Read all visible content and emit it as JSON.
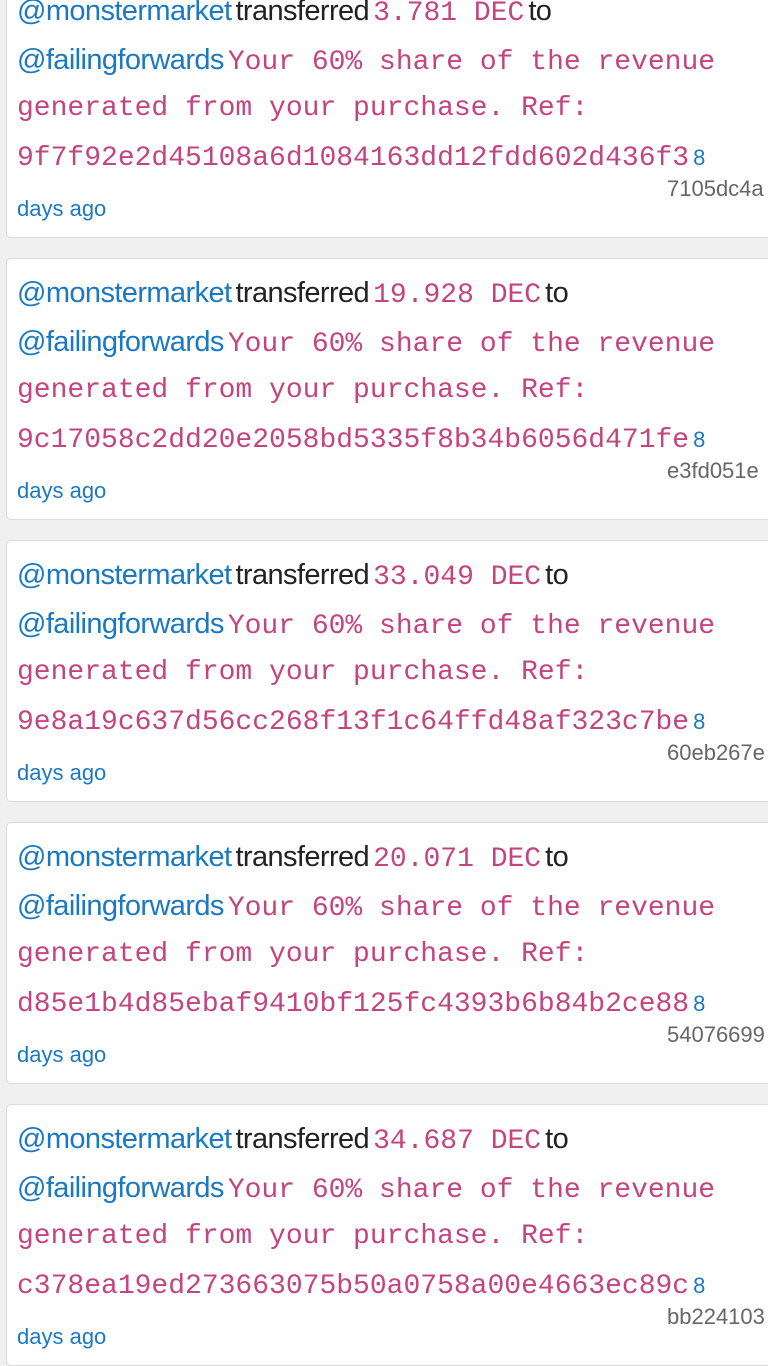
{
  "colors": {
    "user": "#1b78c2",
    "memo": "#c4447f",
    "txid": "#666666",
    "background": "#f0f0f0"
  },
  "transfers": [
    {
      "from": "@monstermarket",
      "verb": "transferred",
      "amount": "3.781 DEC",
      "to_word": "to",
      "to": "@failingforwards",
      "memo1": "Your 60% share of the revenue",
      "memo2": "generated from your purchase. Ref:",
      "ref": "9f7f92e2d45108a6d1084163dd12fdd602d436f3",
      "age_num": "8",
      "age_rest": "days ago",
      "txid": "7105dc4a"
    },
    {
      "from": "@monstermarket",
      "verb": "transferred",
      "amount": "19.928 DEC",
      "to_word": "to",
      "to": "@failingforwards",
      "memo1": "Your 60% share of the revenue",
      "memo2": "generated from your purchase. Ref:",
      "ref": "9c17058c2dd20e2058bd5335f8b34b6056d471fe",
      "age_num": "8",
      "age_rest": "days ago",
      "txid": "e3fd051e"
    },
    {
      "from": "@monstermarket",
      "verb": "transferred",
      "amount": "33.049 DEC",
      "to_word": "to",
      "to": "@failingforwards",
      "memo1": "Your 60% share of the revenue",
      "memo2": "generated from your purchase. Ref:",
      "ref": "9e8a19c637d56cc268f13f1c64ffd48af323c7be",
      "age_num": "8",
      "age_rest": "days ago",
      "txid": "60eb267e"
    },
    {
      "from": "@monstermarket",
      "verb": "transferred",
      "amount": "20.071 DEC",
      "to_word": "to",
      "to": "@failingforwards",
      "memo1": "Your 60% share of the revenue",
      "memo2": "generated from your purchase. Ref:",
      "ref": "d85e1b4d85ebaf9410bf125fc4393b6b84b2ce88",
      "age_num": "8",
      "age_rest": "days ago",
      "txid": "54076699"
    },
    {
      "from": "@monstermarket",
      "verb": "transferred",
      "amount": "34.687 DEC",
      "to_word": "to",
      "to": "@failingforwards",
      "memo1": "Your 60% share of the revenue",
      "memo2": "generated from your purchase. Ref:",
      "ref": "c378ea19ed273663075b50a0758a00e4663ec89c",
      "age_num": "8",
      "age_rest": "days ago",
      "txid": "bb224103"
    }
  ]
}
